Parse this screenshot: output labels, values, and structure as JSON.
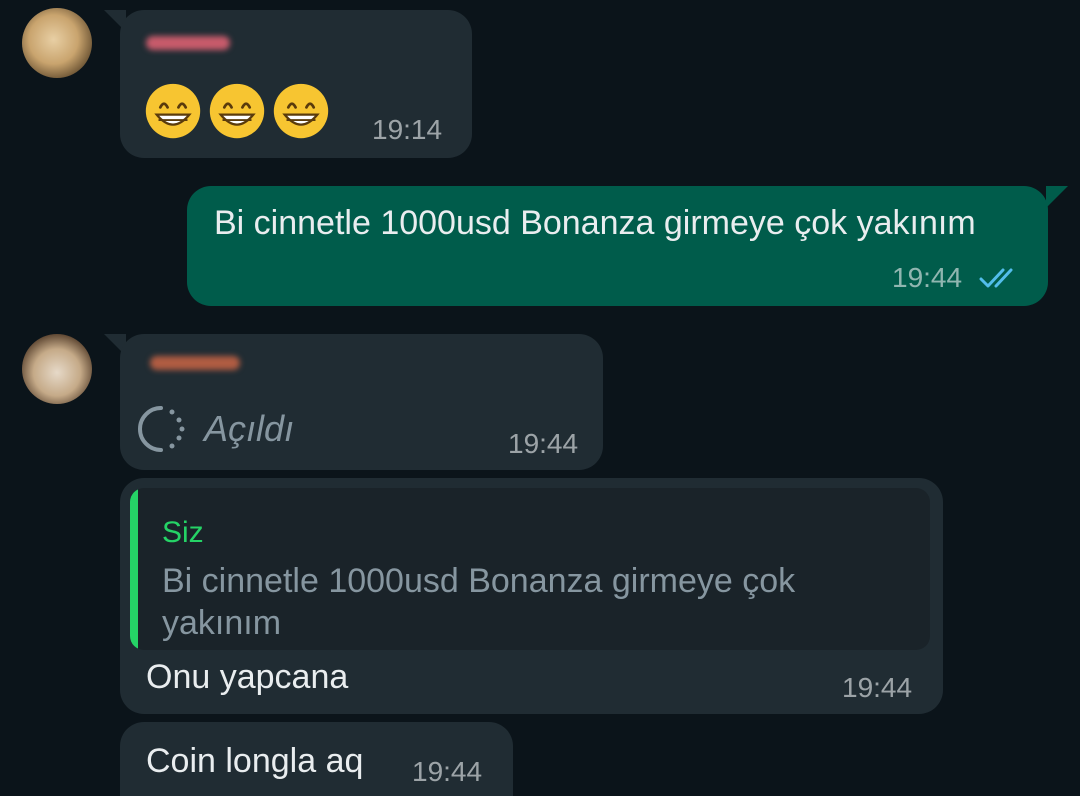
{
  "messages": [
    {
      "direction": "incoming",
      "emojis": [
        "😁",
        "😁",
        "😁"
      ],
      "time": "19:14"
    },
    {
      "direction": "outgoing",
      "text": "Bi cinnetle 1000usd Bonanza girmeye çok yakınım",
      "time": "19:44",
      "status": "read"
    },
    {
      "direction": "incoming",
      "status_text": "Açıldı",
      "time": "19:44"
    },
    {
      "direction": "incoming",
      "quote": {
        "sender": "Siz",
        "line1": "Bi cinnetle 1000usd Bonanza girmeye çok",
        "line2": "yakınım"
      },
      "text": "Onu yapcana",
      "time": "19:44"
    },
    {
      "direction": "incoming",
      "text": "Coin longla aq",
      "time": "19:44"
    }
  ],
  "colors": {
    "background": "#0b141a",
    "incoming_bubble": "#202c33",
    "outgoing_bubble": "#005c4b",
    "quote_accent": "#25d366",
    "read_ticks": "#53bdeb"
  }
}
